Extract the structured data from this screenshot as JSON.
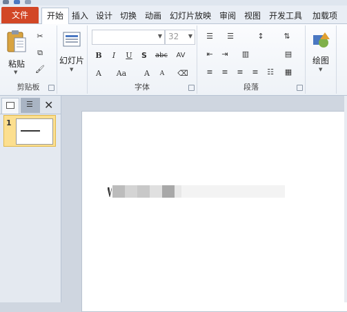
{
  "tabs": [
    "文件",
    "开始",
    "插入",
    "设计",
    "切换",
    "动画",
    "幻灯片放映",
    "审阅",
    "视图",
    "开发工具",
    "加载项"
  ],
  "clipboard": {
    "paste_label": "粘贴",
    "group_label": "剪贴板"
  },
  "slides": {
    "new_slide_label": "幻灯片"
  },
  "font": {
    "name_value": "",
    "size_value": "32",
    "group_label": "字体"
  },
  "paragraph": {
    "group_label": "段落"
  },
  "drawing": {
    "label": "绘图"
  },
  "slide_panel": {
    "slide_number": "1"
  },
  "colors": {
    "file_tab": "#d24726",
    "thumb_highlight": "#fcdf8f"
  }
}
